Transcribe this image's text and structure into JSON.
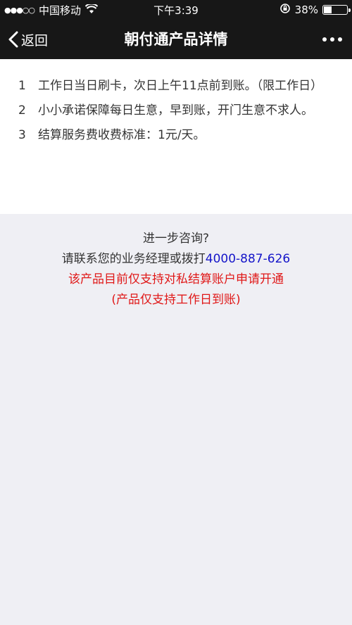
{
  "status_bar": {
    "signal": "●●●○○",
    "carrier": "中国移动",
    "time": "下午3:39",
    "battery": "38%",
    "battery_level": 0.38
  },
  "nav": {
    "back_label": "返回",
    "title": "朝付通产品详情"
  },
  "details": [
    {
      "num": "1",
      "text": "工作日当日刷卡，次日上午11点前到账。（限工作日）"
    },
    {
      "num": "2",
      "text": "小小承诺保障每日生意，早到账，开门生意不求人。"
    },
    {
      "num": "3",
      "text": "结算服务费收费标准：1元/天。"
    }
  ],
  "contact": {
    "question": "进一步咨询?",
    "prompt": "请联系您的业务经理或拨打",
    "phone": "4000-887-626",
    "notice": "该产品目前仅支持对私结算账户申请开通",
    "notice2": "(产品仅支持工作日到账)"
  },
  "colors": {
    "bar_bg": "#171717",
    "phone": "#1515c9",
    "notice": "#e01818"
  }
}
